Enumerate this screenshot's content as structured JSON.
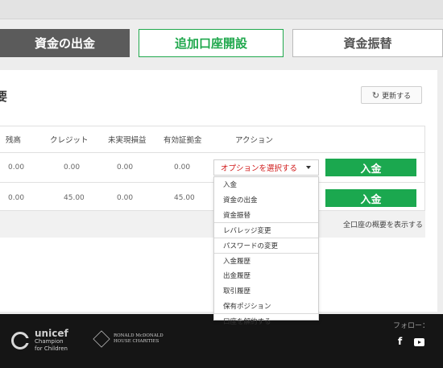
{
  "tabs": [
    {
      "label": "資金の出金"
    },
    {
      "label": "追加口座開設"
    },
    {
      "label": "資金振替"
    }
  ],
  "panel": {
    "title": "要",
    "refresh_label": "更新する"
  },
  "table": {
    "headers": [
      "残高",
      "クレジット",
      "未実現損益",
      "有効証拠金",
      "アクション"
    ],
    "rows": [
      {
        "balance": "0.00",
        "credit": "0.00",
        "unrealized": "0.00",
        "equity": "0.00"
      },
      {
        "balance": "0.00",
        "credit": "45.00",
        "unrealized": "0.00",
        "equity": "45.00"
      }
    ],
    "select_label": "オプションを選択する",
    "deposit_label": "入金"
  },
  "summary_link": "全口座の概要を表示する",
  "dropdown": {
    "items": [
      "入金",
      "資金の出金",
      "資金振替",
      "レバレッジ変更",
      "パスワードの変更",
      "入金履歴",
      "出金履歴",
      "取引履歴",
      "保有ポジション",
      "口座を解約する"
    ]
  },
  "footer": {
    "unicef_line1": "unicef",
    "unicef_line2": "Champion",
    "unicef_line3": "for Children",
    "rmhc_line1": "RONALD McDONALD",
    "rmhc_line2": "HOUSE CHARITIES",
    "follow_label": "フォロー：",
    "facebook_glyph": "f"
  },
  "colors": {
    "accent_green": "#1ba84f",
    "select_red": "#d01818",
    "footer_bg": "#151515"
  }
}
